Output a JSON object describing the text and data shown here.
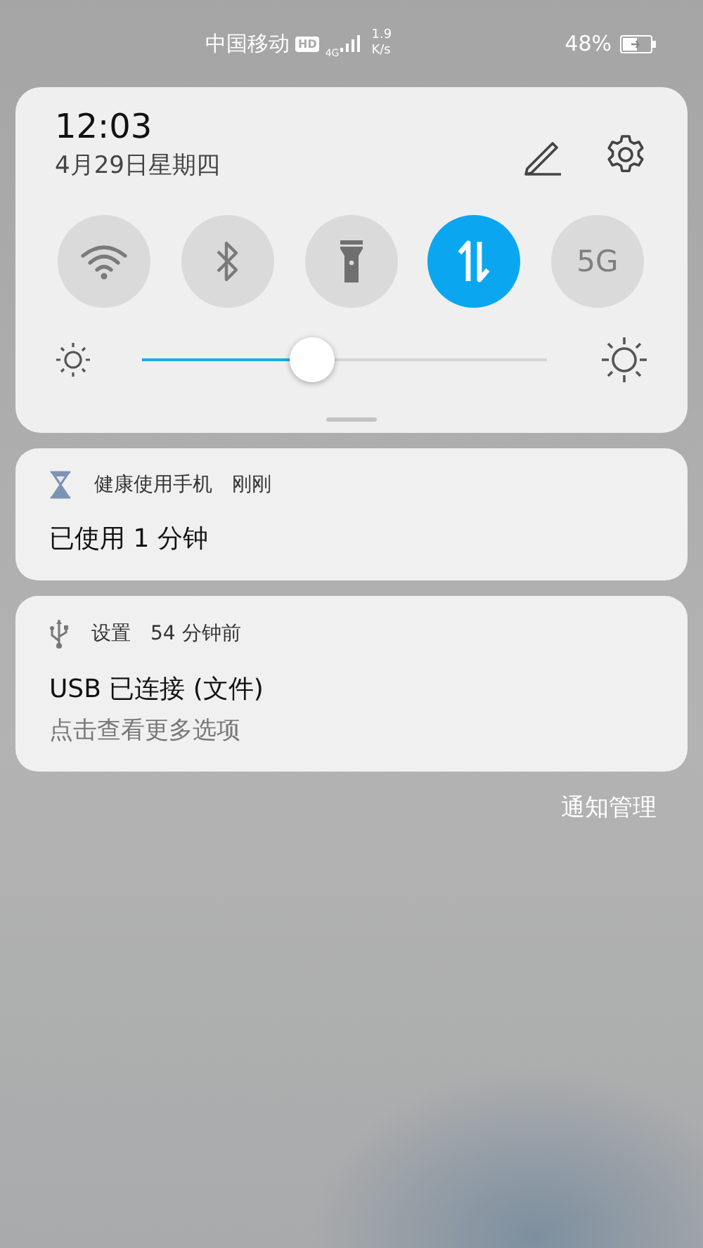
{
  "status_bar": {
    "carrier": "中国移动",
    "hd_badge": "HD",
    "network": "4G",
    "speed_value": "1.9",
    "speed_unit": "K/s",
    "battery": "48%",
    "charging": true
  },
  "quick_panel": {
    "time": "12:03",
    "date": "4月29日星期四",
    "tiles": [
      {
        "kind": "wifi",
        "on": false
      },
      {
        "kind": "bluetooth",
        "on": false
      },
      {
        "kind": "flashlight",
        "on": false
      },
      {
        "kind": "data",
        "on": true
      },
      {
        "kind": "text",
        "label": "5G",
        "on": false
      }
    ],
    "brightness": {
      "level": 0.42
    }
  },
  "notifications": [
    {
      "kind": "hourglass",
      "app": "健康使用手机",
      "time": "刚刚",
      "title": "已使用 1 分钟"
    },
    {
      "kind": "usb",
      "app": "设置",
      "time": "54 分钟前",
      "title": "USB 已连接 (文件)",
      "body": "点击查看更多选项"
    }
  ],
  "manage_link": "通知管理"
}
